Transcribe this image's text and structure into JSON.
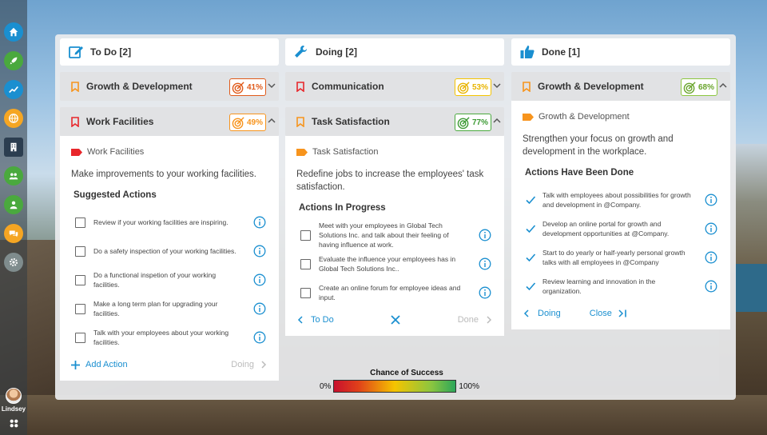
{
  "user": {
    "name": "Lindsey"
  },
  "nav": [
    "home-icon",
    "rocket-icon",
    "trend-icon",
    "globe-icon",
    "building-icon",
    "group-icon",
    "person-icon",
    "chat-icon",
    "gear-icon"
  ],
  "colors": {
    "orange": "#f7941d",
    "red": "#e8262b",
    "yellow": "#f5c400",
    "green": "#4aa93e",
    "blue": "#1a8fd0"
  },
  "columns": {
    "todo": {
      "title": "To Do [2]",
      "tasks": [
        {
          "label": "Growth & Development",
          "pct": "41%"
        },
        {
          "label": "Work Facilities",
          "pct": "49%"
        }
      ],
      "card": {
        "tag": "Work Facilities",
        "desc": "Make improvements to your working facilities.",
        "subtitle": "Suggested Actions",
        "actions": [
          "Review if your working facilities are inspiring.",
          "Do a safety inspection of your working facilities.",
          "Do a functional inspetion of your working facilities.",
          "Make a long term plan for upgrading your facilities.",
          "Talk with your employees about your working facilities."
        ],
        "add_action": "Add Action",
        "next": "Doing"
      }
    },
    "doing": {
      "title": "Doing [2]",
      "tasks": [
        {
          "label": "Communication",
          "pct": "53%"
        },
        {
          "label": "Task Satisfaction",
          "pct": "77%"
        }
      ],
      "card": {
        "tag": "Task Satisfaction",
        "desc": "Redefine jobs to increase the employees' task satisfaction.",
        "subtitle": "Actions In Progress",
        "actions": [
          "Meet with your employees in Global Tech Solutions Inc. and talk about their feeling of having influence at work.",
          "Evaluate the influence your employees has in Global Tech Solutions Inc..",
          "Create an online forum for employee ideas and input."
        ],
        "prev": "To Do",
        "next": "Done"
      }
    },
    "done": {
      "title": "Done [1]",
      "tasks": [
        {
          "label": "Growth & Development",
          "pct": "68%"
        }
      ],
      "card": {
        "tag": "Growth & Development",
        "desc": "Strengthen your focus on growth and development in the workplace.",
        "subtitle": "Actions Have Been Done",
        "actions": [
          "Talk with employees about possibilities for growth and development in @Company.",
          "Develop an online portal for growth and development opportunities at @Company.",
          "Start to do yearly or half-yearly personal growth talks with all employees in @Company",
          "Review learning and innovation in the organization."
        ],
        "prev": "Doing",
        "close": "Close"
      }
    }
  },
  "legend": {
    "title": "Chance of Success",
    "min": "0%",
    "max": "100%"
  }
}
